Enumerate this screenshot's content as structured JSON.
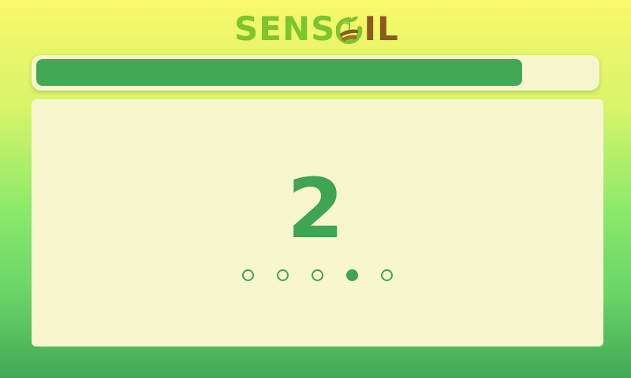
{
  "logo": {
    "part1": "SENS",
    "part2": "IL"
  },
  "progress": {
    "value": 0.87
  },
  "countdown": {
    "value": "2"
  },
  "dots": {
    "count": 5,
    "active_index": 3
  },
  "colors": {
    "accent": "#43a854",
    "panel": "#f7f6cf",
    "logo_green": "#7cc52e",
    "logo_brown": "#8b5a1e"
  }
}
